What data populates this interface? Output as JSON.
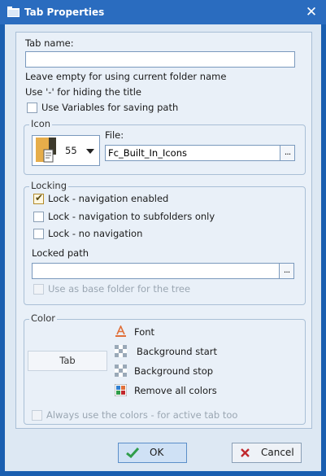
{
  "window": {
    "title": "Tab Properties",
    "close_glyph": "✕"
  },
  "tab_name": {
    "label": "Tab name:",
    "value": "",
    "hint_1": "Leave empty for using current folder name",
    "hint_2": "Use '-' for hiding the title",
    "use_variables_label": "Use Variables for saving path"
  },
  "icon_group": {
    "title": "Icon",
    "icon_number": "55",
    "file_label": "File:",
    "file_value": "Fc_Built_In_Icons",
    "browse_label": "..."
  },
  "locking_group": {
    "title": "Locking",
    "options": [
      {
        "label": "Lock - navigation enabled",
        "checked": true
      },
      {
        "label": "Lock - navigation to subfolders only",
        "checked": false
      },
      {
        "label": "Lock - no navigation",
        "checked": false
      }
    ],
    "locked_path_label": "Locked path",
    "locked_path_value": "",
    "browse_label": "...",
    "use_as_base_label": "Use as base folder for the tree"
  },
  "color_group": {
    "title": "Color",
    "tab_preview_label": "Tab",
    "items": [
      {
        "label": "Font",
        "icon": "font-color-icon"
      },
      {
        "label": "Background start",
        "icon": "checker-icon"
      },
      {
        "label": "Background stop",
        "icon": "checker-icon"
      },
      {
        "label": "Remove all colors",
        "icon": "palette-icon"
      }
    ],
    "always_use_label": "Always use the colors - for active tab too"
  },
  "buttons": {
    "ok": "OK",
    "cancel": "Cancel"
  },
  "colors": {
    "titlebar": "#2a6cbf",
    "accent_check": "#2f9d4a",
    "cancel_x": "#c0282d",
    "font_a": "#e0703a"
  }
}
